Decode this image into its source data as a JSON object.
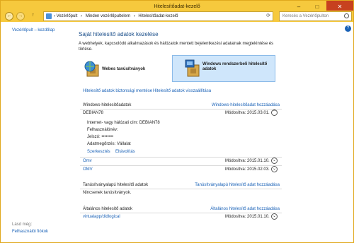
{
  "window": {
    "title": "Hitelesítőadat-kezelő",
    "minimize": "–",
    "maximize": "□",
    "close": "✕"
  },
  "nav": {
    "back": "←",
    "forward": "→",
    "up": "↑",
    "breadcrumb": [
      "Vezérlőpult",
      "Minden vezérlőpultelem",
      "Hitelesítőadat-kezelő"
    ],
    "separator": "›",
    "search_placeholder": "Keresés a Vezérlőpulton",
    "refresh": "⟳"
  },
  "sidebar": {
    "home": "Vezérlőpult – kezdőlap",
    "see_also": "Lásd még:",
    "user_accounts": "Felhasználói fiókok"
  },
  "help_icon": "?",
  "main": {
    "heading": "Saját hitelesítő adatok kezelése",
    "description": "A webhelyek, kapcsolódó alkalmazások és hálózatok mentett bejelentkezési adatainak megtekintése és törlése.",
    "web_credentials": "Webes tanúsítványok",
    "windows_credentials": "Windows rendszerbeli hitelesítő adatok",
    "backup": "Hitelesítő adatok biztonsági mentése",
    "restore": "Hitelesítő adatok visszaállítása",
    "windows_section": {
      "title": "Windows-hitelesítőadatok",
      "add": "Windows-hitelesítőadat hozzáadása",
      "expanded": {
        "name": "DEBIAN78",
        "modified": "Módosítva:  2015.03.01.",
        "details": [
          "Internet- vagy hálózati cím:  DEBIAN78",
          "Felhasználónév:",
          "Jelszó:  ••••••••",
          "Adatmegőrzés:  Vállalat"
        ],
        "edit": "Szerkesztés",
        "remove": "Eltávolítás"
      },
      "items": [
        {
          "name": "Omv",
          "modified": "Módosítva:  2015.01.10."
        },
        {
          "name": "OMV",
          "modified": "Módosítva:  2015.02.03."
        }
      ]
    },
    "cert_section": {
      "title": "Tanúsítványalapú hitelesítő adatok",
      "add": "Tanúsítványalapú hitelesítő adat hozzáadása",
      "empty": "Nincsenek tanúsítványok."
    },
    "general_section": {
      "title": "Általános hitelesítő adatok",
      "add": "Általános hitelesítő adat hozzáadása",
      "items": [
        {
          "name": "virtualapp/didlogical",
          "modified": "Módosítva:  2015.01.10."
        }
      ]
    }
  }
}
